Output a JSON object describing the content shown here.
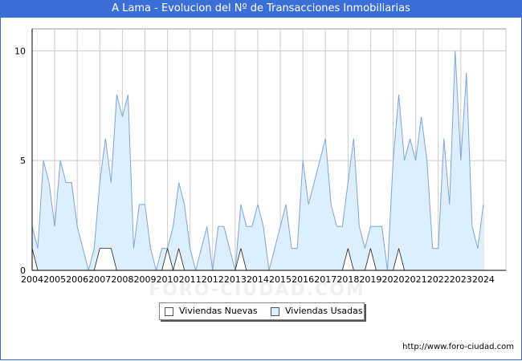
{
  "title": "A Lama - Evolucion del Nº de Transacciones Inmobiliarias",
  "source": "http://www.foro-ciudad.com",
  "watermark": "FORO-CIUDAD.COM",
  "legend": {
    "nuevas_label": "Viviendas Nuevas",
    "usadas_label": "Viviendas Usadas"
  },
  "colors": {
    "title_bg": "#3a6fd8",
    "usadas_fill": "#ddeefc",
    "usadas_line": "#7fa6d8",
    "nuevas_fill": "#ffffff",
    "nuevas_line": "#222222",
    "grid": "#cccccc"
  },
  "chart_data": {
    "type": "area",
    "title": "A Lama - Evolucion del Nº de Transacciones Inmobiliarias",
    "x_tick_labels": [
      "2004",
      "2005",
      "2006",
      "2007",
      "2008",
      "2009",
      "2010",
      "2011",
      "2012",
      "2013",
      "2014",
      "2015",
      "2016",
      "2017",
      "2018",
      "2019",
      "2020",
      "2021",
      "2022",
      "2023",
      "2024"
    ],
    "y_tick_labels": [
      "0",
      "5",
      "10"
    ],
    "ylim": [
      0,
      11
    ],
    "grid": true,
    "legend_position": "bottom",
    "x_start": 2004,
    "points_per_year": 4,
    "series": [
      {
        "name": "Viviendas Usadas",
        "values": [
          2,
          1,
          5,
          4,
          2,
          5,
          4,
          4,
          2,
          1,
          0,
          1,
          4,
          6,
          4,
          8,
          7,
          8,
          1,
          3,
          3,
          1,
          0,
          1,
          1,
          2,
          4,
          3,
          1,
          0,
          1,
          2,
          0,
          2,
          2,
          1,
          0,
          3,
          2,
          2,
          3,
          2,
          0,
          1,
          2,
          3,
          1,
          1,
          5,
          3,
          4,
          5,
          6,
          3,
          2,
          2,
          4,
          6,
          2,
          1,
          2,
          2,
          2,
          0,
          5,
          8,
          5,
          6,
          5,
          7,
          5,
          1,
          1,
          6,
          3,
          10,
          5,
          9,
          2,
          1,
          3
        ]
      },
      {
        "name": "Viviendas Nuevas",
        "values": [
          1,
          0,
          0,
          0,
          0,
          0,
          0,
          0,
          0,
          0,
          0,
          0,
          1,
          1,
          1,
          0,
          0,
          0,
          0,
          0,
          0,
          0,
          0,
          0,
          1,
          0,
          1,
          0,
          0,
          0,
          0,
          0,
          0,
          0,
          0,
          0,
          0,
          1,
          0,
          0,
          0,
          0,
          0,
          0,
          0,
          0,
          0,
          0,
          0,
          0,
          0,
          0,
          0,
          0,
          0,
          0,
          1,
          0,
          0,
          0,
          1,
          0,
          0,
          0,
          0,
          1,
          0,
          0,
          0,
          0,
          0,
          0,
          0,
          0,
          0,
          0,
          0,
          0,
          0,
          0,
          0
        ]
      }
    ]
  }
}
